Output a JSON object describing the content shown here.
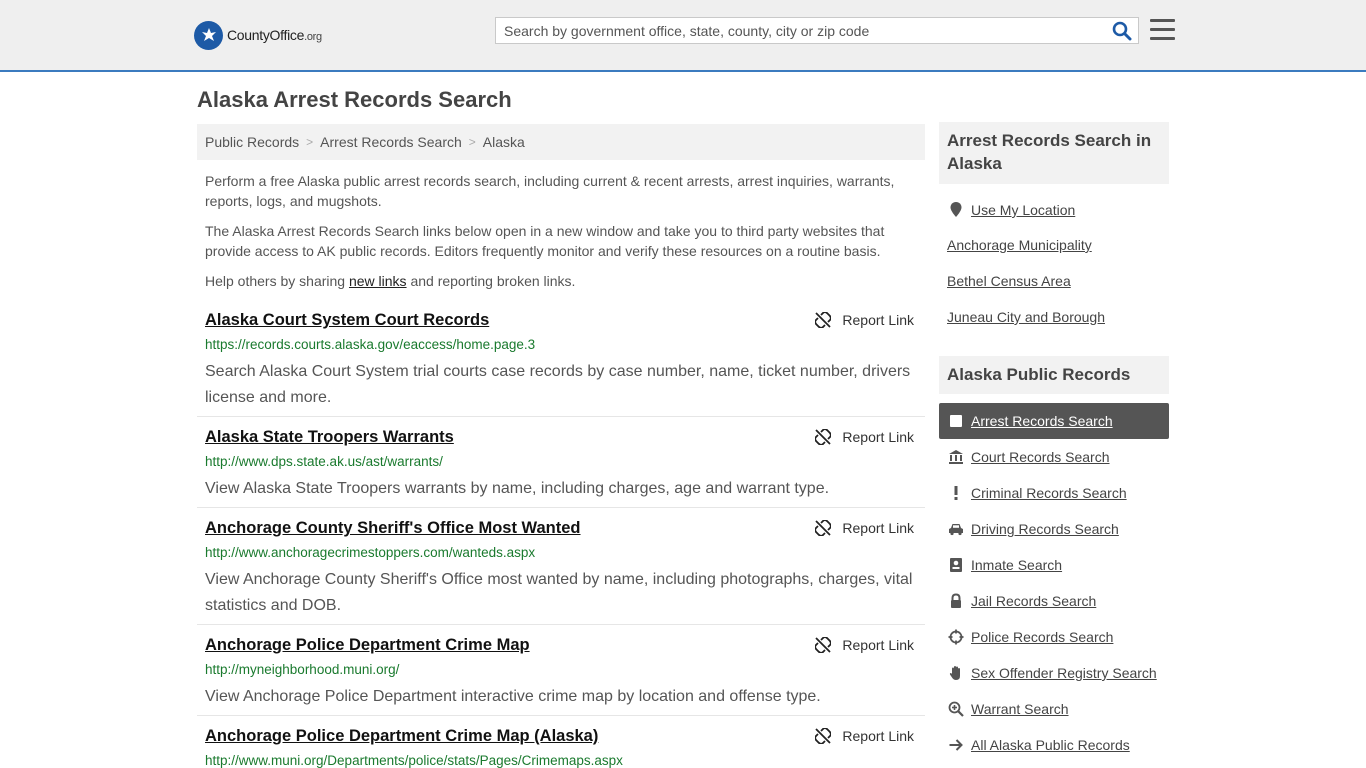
{
  "header": {
    "logo_name": "CountyOffice",
    "logo_tld": ".org",
    "search_placeholder": "Search by government office, state, county, city or zip code",
    "search_value": ""
  },
  "page_title": "Alaska Arrest Records Search",
  "breadcrumb": [
    "Public Records",
    "Arrest Records Search",
    "Alaska"
  ],
  "intro": {
    "p1": "Perform a free Alaska public arrest records search, including current & recent arrests, arrest inquiries, warrants, reports, logs, and mugshots.",
    "p2": "The Alaska Arrest Records Search links below open in a new window and take you to third party websites that provide access to AK public records. Editors frequently monitor and verify these resources on a routine basis.",
    "p3_before": "Help others by sharing ",
    "p3_link": "new links",
    "p3_after": " and reporting broken links."
  },
  "report_label": "Report Link",
  "listings": [
    {
      "title": "Alaska Court System Court Records",
      "url": "https://records.courts.alaska.gov/eaccess/home.page.3",
      "desc": "Search Alaska Court System trial courts case records by case number, name, ticket number, drivers license and more."
    },
    {
      "title": "Alaska State Troopers Warrants",
      "url": "http://www.dps.state.ak.us/ast/warrants/",
      "desc": "View Alaska State Troopers warrants by name, including charges, age and warrant type."
    },
    {
      "title": "Anchorage County Sheriff's Office Most Wanted",
      "url": "http://www.anchoragecrimestoppers.com/wanteds.aspx",
      "desc": "View Anchorage County Sheriff's Office most wanted by name, including photographs, charges, vital statistics and DOB."
    },
    {
      "title": "Anchorage Police Department Crime Map",
      "url": "http://myneighborhood.muni.org/",
      "desc": "View Anchorage Police Department interactive crime map by location and offense type."
    },
    {
      "title": "Anchorage Police Department Crime Map (Alaska)",
      "url": "http://www.muni.org/Departments/police/stats/Pages/Crimemaps.aspx",
      "desc": ""
    }
  ],
  "sidebar": {
    "locations_heading": "Arrest Records Search in Alaska",
    "use_location": "Use My Location",
    "locations": [
      "Anchorage Municipality",
      "Bethel Census Area",
      "Juneau City and Borough"
    ],
    "records_heading": "Alaska Public Records",
    "records": [
      {
        "label": "Arrest Records Search",
        "icon": "square-icon",
        "active": true
      },
      {
        "label": "Court Records Search",
        "icon": "courthouse-icon",
        "active": false
      },
      {
        "label": "Criminal Records Search",
        "icon": "exclamation-icon",
        "active": false
      },
      {
        "label": "Driving Records Search",
        "icon": "car-icon",
        "active": false
      },
      {
        "label": "Inmate Search",
        "icon": "id-card-icon",
        "active": false
      },
      {
        "label": "Jail Records Search",
        "icon": "lock-icon",
        "active": false
      },
      {
        "label": "Police Records Search",
        "icon": "crosshair-icon",
        "active": false
      },
      {
        "label": "Sex Offender Registry Search",
        "icon": "hand-icon",
        "active": false
      },
      {
        "label": "Warrant Search",
        "icon": "magnify-plus-icon",
        "active": false
      },
      {
        "label": "All Alaska Public Records",
        "icon": "arrow-right-icon",
        "active": false
      }
    ]
  },
  "colors": {
    "accent": "#3b7bbf",
    "url_green": "#1a7a2e",
    "active_bg": "#555555"
  }
}
